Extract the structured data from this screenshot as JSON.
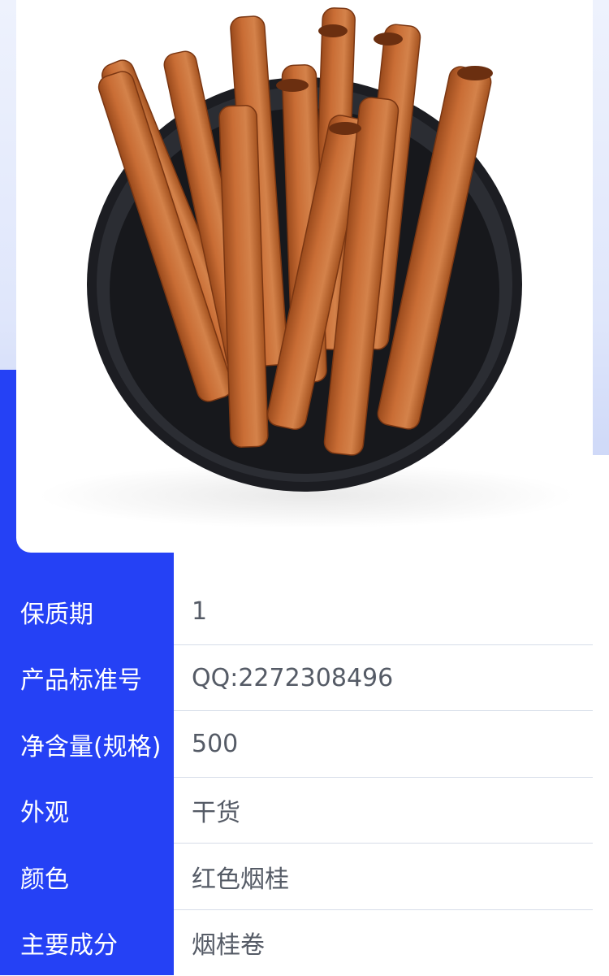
{
  "colors": {
    "accent": "#2541f5",
    "background_top": "#dfe6fb",
    "label_text": "#ffffff",
    "value_text": "#555b66"
  },
  "product": {
    "image": "cinnamon-sticks-in-black-bowl"
  },
  "specs": [
    {
      "label": "保质期",
      "value": "1"
    },
    {
      "label": "产品标准号",
      "value": "QQ:2272308496"
    },
    {
      "label": "净含量(规格)",
      "value": "500"
    },
    {
      "label": "外观",
      "value": "干货"
    },
    {
      "label": "颜色",
      "value": "红色烟桂"
    },
    {
      "label": "主要成分",
      "value": "烟桂卷"
    }
  ]
}
